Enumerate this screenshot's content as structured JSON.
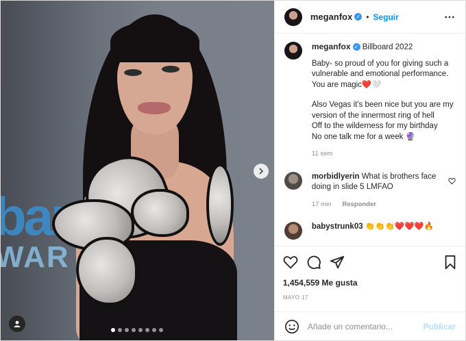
{
  "post": {
    "carousel": {
      "next_icon": "chevron-right-icon",
      "user_tag_icon": "user-icon",
      "slide_count": 8,
      "active_slide": 1
    },
    "header": {
      "username": "meganfox",
      "separator": "•",
      "follow_label": "Seguir",
      "more_icon": "ellipsis-icon"
    },
    "caption": {
      "username": "meganfox",
      "title": "Billboard 2022",
      "paragraph1": "Baby- so proud of you for giving such a vulnerable and emotional performance. You are magic❤️🤍",
      "paragraph2_line1": "Also Vegas it's been nice but you are my version of the innermost ring of hell",
      "paragraph2_line2": "Off to the wilderness for my birthday",
      "paragraph2_line3": "No one talk me for a week 🔮",
      "time": "11 sem"
    },
    "comments": [
      {
        "username": "morbidlyerin",
        "text": "What is brothers face doing in slide 5 LMFAO",
        "time": "17 min",
        "reply_label": "Responder"
      },
      {
        "username": "babystrunk03",
        "text": "👏👏👏❤️❤️❤️🔥"
      }
    ],
    "actions": {
      "likes": "1,454,559 Me gusta",
      "date": "MAYO 17"
    },
    "add_comment": {
      "placeholder": "Añade un comentario...",
      "publish_label": "Publicar"
    },
    "colors": {
      "accent": "#0095f6",
      "publish_disabled": "#b2dffc",
      "verified": "#3897f0",
      "muted": "#8e8e8e"
    }
  }
}
